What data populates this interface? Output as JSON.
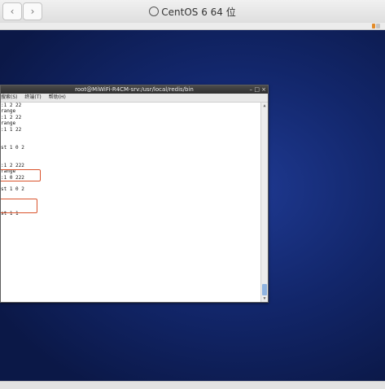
{
  "host": {
    "title": "CentOS 6 64 位",
    "back_glyph": "‹",
    "forward_glyph": "›"
  },
  "terminal": {
    "title": "root@MiWiFi-R4CM-srv:/usr/local/redis/bin",
    "controls": [
      "–",
      "□",
      "×"
    ],
    "menu": [
      "搜索(S)",
      "终端(T)",
      "帮助(H)"
    ],
    "lines": [
      ":1 2 22",
      "range",
      ":1 2 22",
      "range",
      ":1 1 22",
      "",
      "",
      "st 1 0 2",
      "",
      "",
      ":1 2 222",
      "range",
      ":1 0 222",
      "",
      "st 1 0 2",
      "",
      "",
      "",
      "st 1 1",
      ""
    ]
  },
  "colors": {
    "highlight": "#d9532c",
    "desktop": "#12266a"
  }
}
